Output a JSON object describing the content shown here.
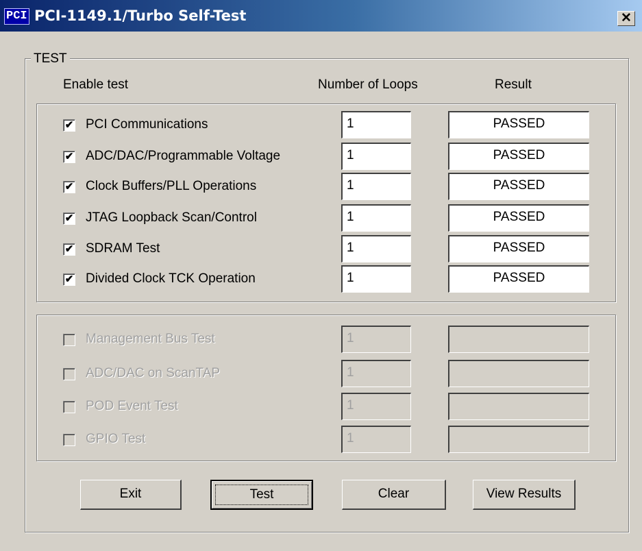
{
  "window": {
    "icon_text": "PCI",
    "title": "PCI-1149.1/Turbo Self-Test",
    "close_glyph": "✕"
  },
  "group": {
    "label": "TEST"
  },
  "headers": {
    "enable": "Enable test",
    "loops": "Number of Loops",
    "result": "Result"
  },
  "active_tests": [
    {
      "label": "PCI Communications",
      "checked": true,
      "loops": "1",
      "result": "PASSED"
    },
    {
      "label": "ADC/DAC/Programmable Voltage",
      "checked": true,
      "loops": "1",
      "result": "PASSED"
    },
    {
      "label": "Clock Buffers/PLL Operations",
      "checked": true,
      "loops": "1",
      "result": "PASSED"
    },
    {
      "label": "JTAG Loopback Scan/Control",
      "checked": true,
      "loops": "1",
      "result": "PASSED"
    },
    {
      "label": "SDRAM Test",
      "checked": true,
      "loops": "1",
      "result": "PASSED"
    },
    {
      "label": "Divided Clock TCK Operation",
      "checked": true,
      "loops": "1",
      "result": "PASSED"
    }
  ],
  "disabled_tests": [
    {
      "label": "Management Bus Test",
      "checked": false,
      "loops": "1",
      "result": ""
    },
    {
      "label": "ADC/DAC on ScanTAP",
      "checked": false,
      "loops": "1",
      "result": ""
    },
    {
      "label": "POD Event Test",
      "checked": false,
      "loops": "1",
      "result": ""
    },
    {
      "label": "GPIO Test",
      "checked": false,
      "loops": "1",
      "result": ""
    }
  ],
  "buttons": {
    "exit": "Exit",
    "test": "Test",
    "clear": "Clear",
    "view_results": "View Results"
  },
  "check_glyph": "✔"
}
